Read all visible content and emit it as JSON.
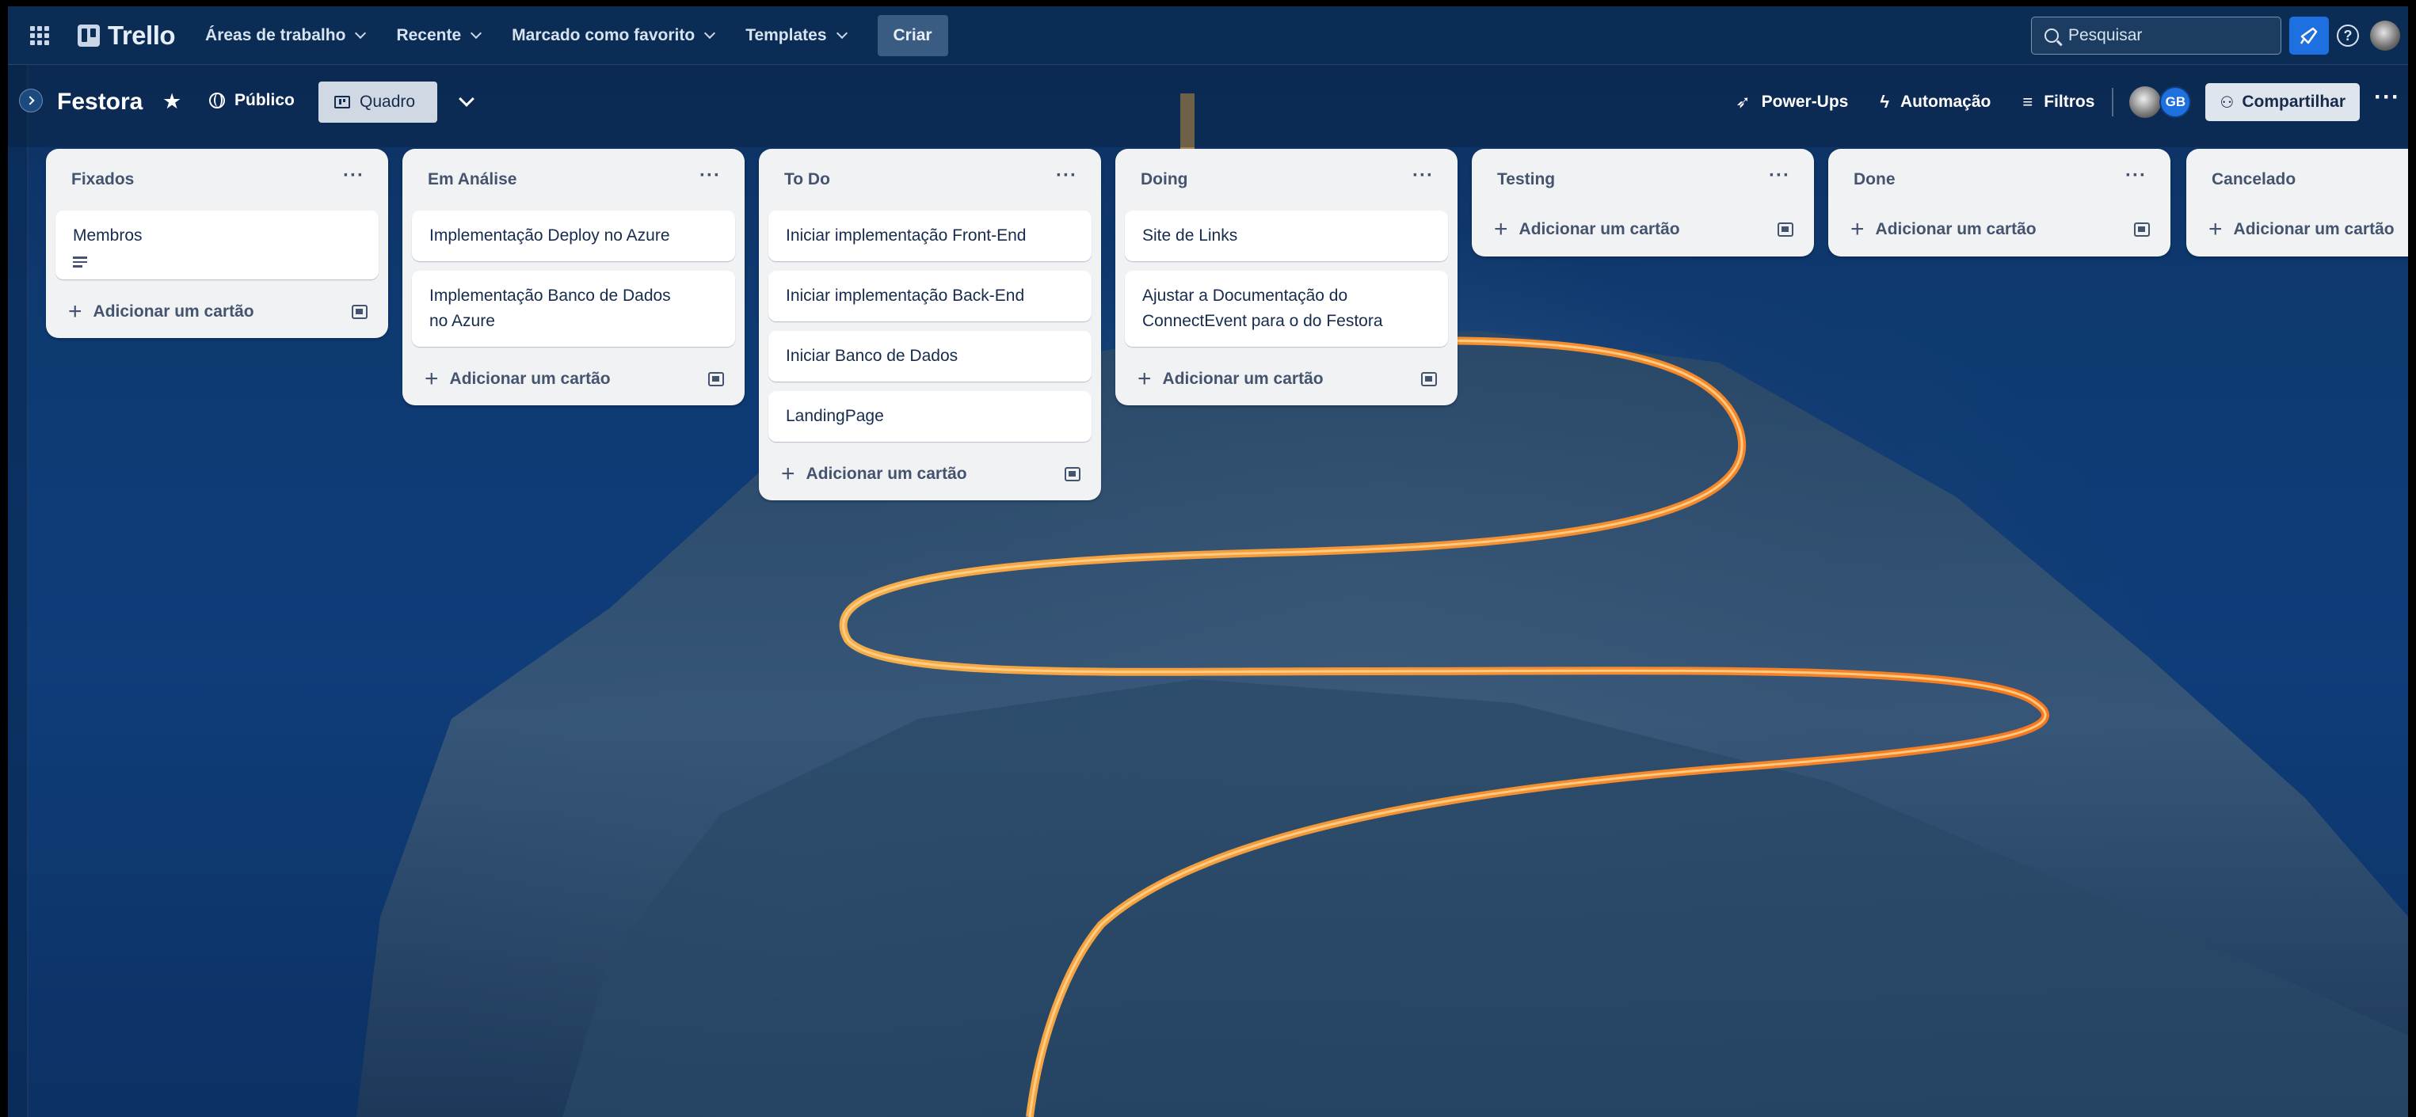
{
  "topnav": {
    "logo": "Trello",
    "menu": [
      {
        "label": "Áreas de trabalho"
      },
      {
        "label": "Recente"
      },
      {
        "label": "Marcado como favorito"
      },
      {
        "label": "Templates"
      }
    ],
    "create_label": "Criar",
    "search_placeholder": "Pesquisar",
    "help_label": "?"
  },
  "board": {
    "title": "Festora",
    "visibility": "Público",
    "view_label": "Quadro",
    "powerups_label": "Power-Ups",
    "automation_label": "Automação",
    "filters_label": "Filtros",
    "member_initials": "GB",
    "share_label": "Compartilhar",
    "more": "···"
  },
  "add_card_label": "Adicionar um cartão",
  "lists": [
    {
      "title": "Fixados",
      "cards": [
        "Membros"
      ]
    },
    {
      "title": "Em Análise",
      "cards": [
        "Implementação Deploy no Azure",
        "Implementação Banco de Dados no Azure"
      ]
    },
    {
      "title": "To Do",
      "cards": [
        "Iniciar implementação Front-End",
        "Iniciar implementação Back-End",
        "Iniciar Banco de Dados",
        "LandingPage"
      ]
    },
    {
      "title": "Doing",
      "cards": [
        "Site de Links",
        "Ajustar a Documentação do ConnectEvent para o do Festora"
      ]
    },
    {
      "title": "Testing",
      "cards": []
    },
    {
      "title": "Done",
      "cards": []
    },
    {
      "title": "Cancelado",
      "cards": []
    }
  ],
  "colors": {
    "nav_bg": "#0a2c55",
    "board_bg": "#0f3d79",
    "list_bg": "#f1f2f4",
    "accent": "#1e6fe0"
  }
}
